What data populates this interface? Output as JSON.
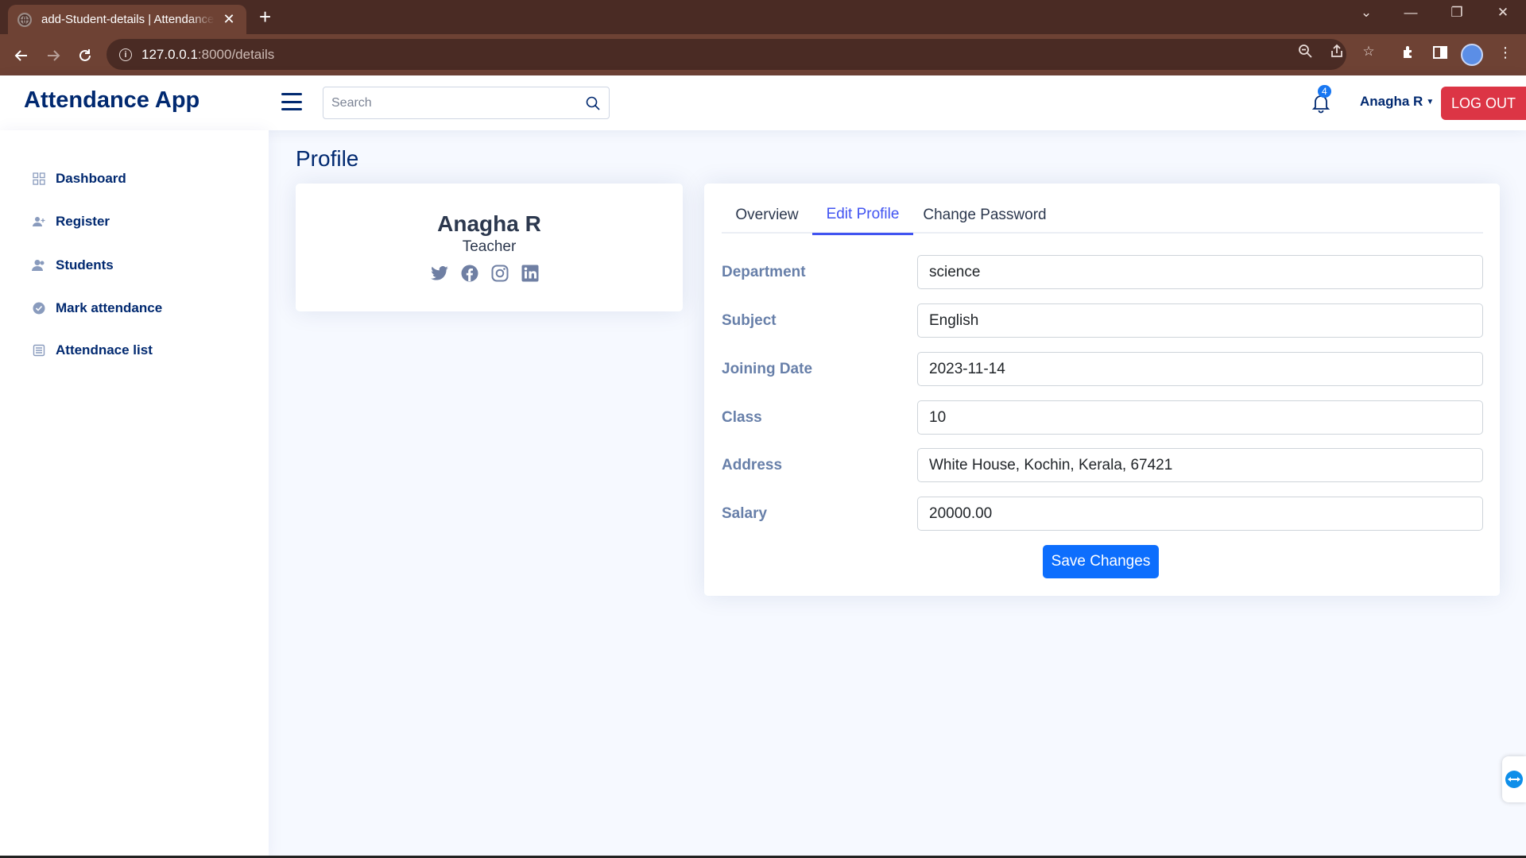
{
  "browser": {
    "tab_title": "add-Student-details | Attendance App",
    "url_host": "127.0.0.1",
    "url_path": ":8000/details"
  },
  "header": {
    "app_name": "Attendance App",
    "search_placeholder": "Search",
    "notification_count": "4",
    "user_name": "Anagha R",
    "logout_label": "LOG OUT"
  },
  "sidebar": {
    "items": [
      {
        "label": "Dashboard",
        "icon": "grid-icon"
      },
      {
        "label": "Register",
        "icon": "person-plus-icon"
      },
      {
        "label": "Students",
        "icon": "people-icon"
      },
      {
        "label": "Mark attendance",
        "icon": "check-circle-icon"
      },
      {
        "label": "Attendnace list",
        "icon": "list-icon"
      }
    ]
  },
  "main": {
    "page_title": "Profile",
    "profile_card": {
      "name": "Anagha R",
      "role": "Teacher",
      "social_icons": [
        "twitter-icon",
        "facebook-icon",
        "instagram-icon",
        "linkedin-icon"
      ]
    },
    "tabs": [
      {
        "label": "Overview",
        "active": false
      },
      {
        "label": "Edit Profile",
        "active": true
      },
      {
        "label": "Change Password",
        "active": false
      }
    ],
    "form": {
      "fields": [
        {
          "label": "Department",
          "value": "science"
        },
        {
          "label": "Subject",
          "value": "English"
        },
        {
          "label": "Joining Date",
          "value": "2023-11-14"
        },
        {
          "label": "Class",
          "value": "10"
        },
        {
          "label": "Address",
          "value": "White House, Kochin, Kerala, 67421"
        },
        {
          "label": "Salary",
          "value": "20000.00"
        }
      ],
      "save_label": "Save Changes"
    }
  },
  "colors": {
    "primary": "#012970",
    "accent": "#4154f1",
    "button_blue": "#0d6efd",
    "logout_red": "#dc3545",
    "browser_frame": "#6e4234"
  }
}
